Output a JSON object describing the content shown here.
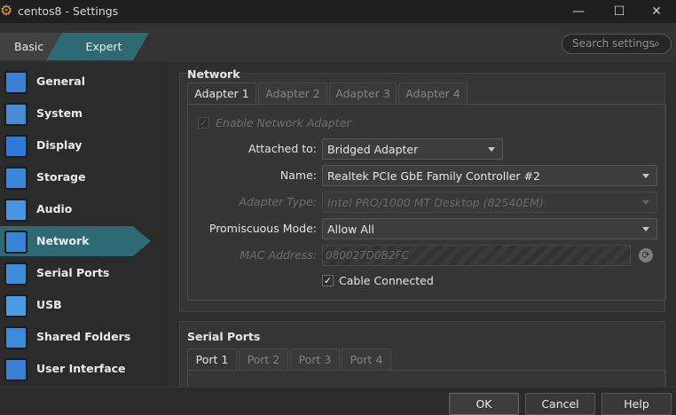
{
  "window": {
    "title": "centos8 - Settings",
    "minimize": "—",
    "maximize": "☐",
    "close": "✕"
  },
  "mode": {
    "basic": "Basic",
    "expert": "Expert"
  },
  "search": {
    "placeholder": "Search settings"
  },
  "sidebar": {
    "items": [
      {
        "label": "General",
        "icon": "general-icon",
        "color": "#3d7fd1"
      },
      {
        "label": "System",
        "icon": "system-icon",
        "color": "#4a8bd6"
      },
      {
        "label": "Display",
        "icon": "display-icon",
        "color": "#2f7ad6"
      },
      {
        "label": "Storage",
        "icon": "storage-icon",
        "color": "#3b86d9"
      },
      {
        "label": "Audio",
        "icon": "audio-icon",
        "color": "#4b95e0"
      },
      {
        "label": "Network",
        "icon": "network-icon",
        "color": "#3a84d8",
        "active": true
      },
      {
        "label": "Serial Ports",
        "icon": "serial-ports-icon",
        "color": "#3f8cdb"
      },
      {
        "label": "USB",
        "icon": "usb-icon",
        "color": "#4a9be4"
      },
      {
        "label": "Shared Folders",
        "icon": "shared-folders-icon",
        "color": "#3d89da"
      },
      {
        "label": "User Interface",
        "icon": "user-interface-icon",
        "color": "#3b80d5"
      }
    ]
  },
  "network": {
    "title": "Network",
    "tabs": [
      "Adapter 1",
      "Adapter 2",
      "Adapter 3",
      "Adapter 4"
    ],
    "enable_label": "Enable Network Adapter",
    "enable_checked": true,
    "attached_label": "Attached to:",
    "attached_value": "Bridged Adapter",
    "name_label": "Name:",
    "name_value": "Realtek PCIe GbE Family Controller #2",
    "adapter_type_label": "Adapter Type:",
    "adapter_type_value": "Intel PRO/1000 MT Desktop (82540EM)",
    "promiscuous_label": "Promiscuous Mode:",
    "promiscuous_value": "Allow All",
    "mac_label": "MAC Address:",
    "mac_value": "080027D0B2FC",
    "cable_label": "Cable Connected",
    "cable_checked": true
  },
  "serial": {
    "title": "Serial Ports",
    "tabs": [
      "Port 1",
      "Port 2",
      "Port 3",
      "Port 4"
    ]
  },
  "buttons": {
    "ok": "OK",
    "cancel": "Cancel",
    "help": "Help"
  },
  "glyphs": {
    "check": "✓",
    "search": "⌕",
    "refresh": "⟳",
    "gear": "⚙"
  }
}
